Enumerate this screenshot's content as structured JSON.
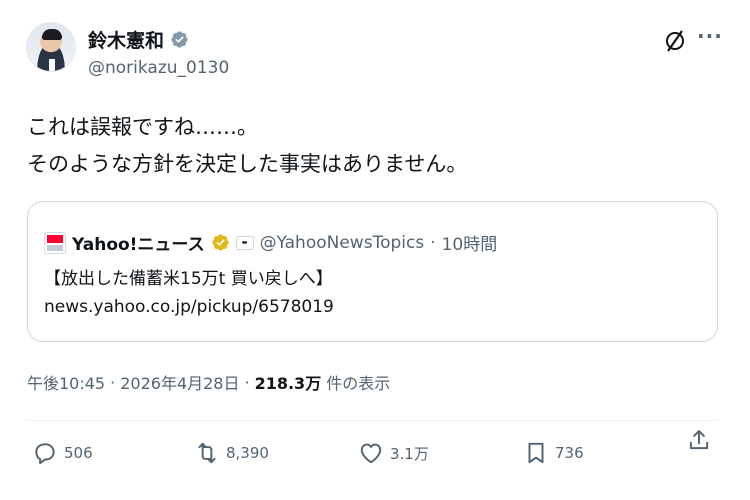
{
  "author": {
    "display_name": "鈴木憲和",
    "handle": "@norikazu_0130",
    "verified": true
  },
  "tweet": {
    "line1": "これは誤報ですね……。",
    "line2": "そのような方針を決定した事実はありません。"
  },
  "quote": {
    "name": "Yahoo!ニュース",
    "handle": "@YahooNewsTopics",
    "separator": "·",
    "time": "10時間",
    "line1": "【放出した備蓄米15万t 買い戻しへ】",
    "line2": "news.yahoo.co.jp/pickup/6578019"
  },
  "meta": {
    "time": "午後10:45",
    "sep1": "·",
    "date": "2026年4月28日",
    "sep2": "·",
    "views": "218.3万",
    "views_label": "件の表示"
  },
  "actions": {
    "replies": "506",
    "retweets": "8,390",
    "likes": "3.1万",
    "bookmarks": "736"
  },
  "icons": {
    "verified": "verified-badge-icon",
    "gold_verified": "gold-verified-badge-icon",
    "grok": "grok-icon",
    "more": "more-options-icon",
    "reply": "reply-icon",
    "retweet": "retweet-icon",
    "like": "heart-icon",
    "bookmark": "bookmark-icon",
    "share": "share-icon"
  },
  "colors": {
    "text_primary": "#0f1419",
    "text_secondary": "#536471",
    "verified_blue_grey": "#829aab",
    "verified_gold": "#e2b719",
    "border": "#cfd9de"
  }
}
